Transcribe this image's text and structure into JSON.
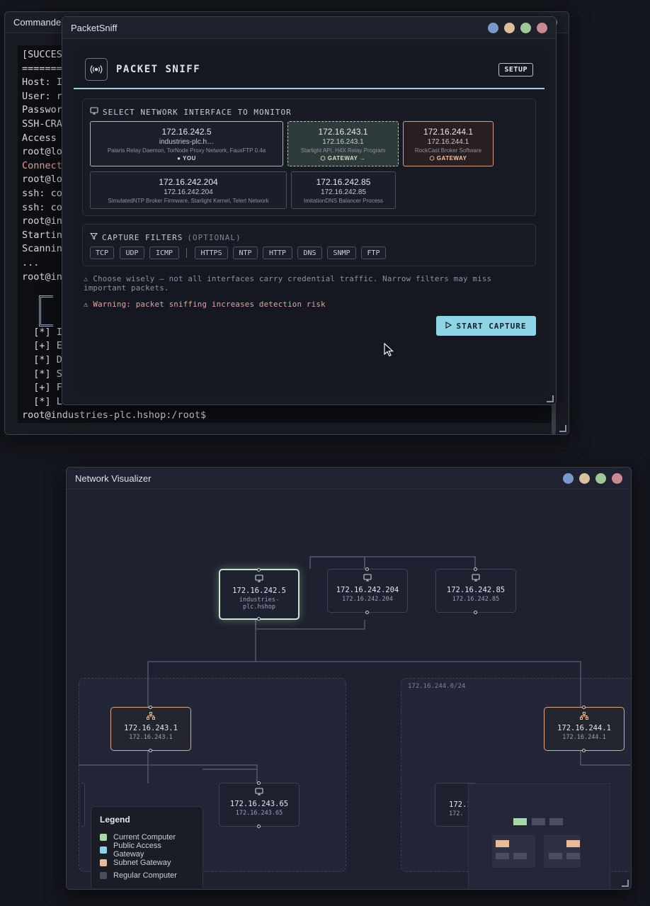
{
  "terminal": {
    "title": "Commander",
    "lines": [
      "[SUCCESS",
      "========",
      "Host: I",
      "User: r",
      "Passwor",
      "SSH-CRA",
      "Access",
      "root@lo",
      "Connect",
      "root@lo",
      "ssh: co",
      "ssh: co",
      "root@in",
      "Startin",
      "Scannin",
      "...",
      "root@in",
      "",
      "",
      "",
      "  [*] I",
      "  [+] E",
      "  [*] D",
      "  [*] S",
      "  [+] F",
      "  [*] L",
      "root@industries-plc.hshop:/root$"
    ]
  },
  "packetsniff": {
    "window_title": "PacketSniff",
    "app_title": "PACKET SNIFF",
    "setup_label": "SETUP",
    "interface_heading": "SELECT NETWORK INTERFACE TO MONITOR",
    "interfaces": [
      {
        "ip": "172.16.242.5",
        "host": "industries-plc.h…",
        "services": "Palaris Relay Daemon, TorNode Proxy Network, FauxFTP 0.4a",
        "tag": "● YOU"
      },
      {
        "ip": "172.16.243.1",
        "host": "172.16.243.1",
        "services": "Starlight API, H4X Relay Program",
        "tag": "⬡ GATEWAY →"
      },
      {
        "ip": "172.16.244.1",
        "host": "172.16.244.1",
        "services": "RockCast Broker Software",
        "tag": "⬡ GATEWAY"
      },
      {
        "ip": "172.16.242.204",
        "host": "172.16.242.204",
        "services": "SimulatedNTP Broker Firmware, Starlight Kernel, Telert Network",
        "tag": ""
      },
      {
        "ip": "172.16.242.85",
        "host": "172.16.242.85",
        "services": "ImitationDNS Balancer Process",
        "tag": ""
      }
    ],
    "filters_heading": "CAPTURE FILTERS",
    "filters_optional": "(OPTIONAL)",
    "protocol_filters": [
      "TCP",
      "UDP",
      "ICMP"
    ],
    "service_filters": [
      "HTTPS",
      "NTP",
      "HTTP",
      "DNS",
      "SNMP",
      "FTP"
    ],
    "hint": "⚠ Choose wisely — not all interfaces carry credential traffic. Narrow filters may miss important packets.",
    "warning": "⚠ Warning: packet sniffing increases detection risk",
    "start_label": "START CAPTURE"
  },
  "netvis": {
    "window_title": "Network Visualizer",
    "subnet_label": "172.16.244.0/24",
    "nodes": {
      "current": {
        "ip": "172.16.242.5",
        "host": "industries-plc.hshop"
      },
      "n204": {
        "ip": "172.16.242.204",
        "sub": "172.16.242.204"
      },
      "n85": {
        "ip": "172.16.242.85",
        "sub": "172.16.242.85"
      },
      "gw243": {
        "ip": "172.16.243.1",
        "sub": "172.16.243.1"
      },
      "gw244": {
        "ip": "172.16.244.1",
        "sub": "172.16.244.1"
      },
      "n65": {
        "ip": "172.16.243.65",
        "sub": "172.16.243.65"
      },
      "partial_right": {
        "ip": "172.1",
        "sub": "172."
      }
    },
    "legend": {
      "title": "Legend",
      "items": [
        {
          "label": "Current Computer",
          "color": "#a6d8a8"
        },
        {
          "label": "Public Access Gateway",
          "color": "#8fd3e6"
        },
        {
          "label": "Subnet Gateway",
          "color": "#e9b99c"
        },
        {
          "label": "Regular Computer",
          "color": "#4a4f60"
        }
      ]
    }
  }
}
